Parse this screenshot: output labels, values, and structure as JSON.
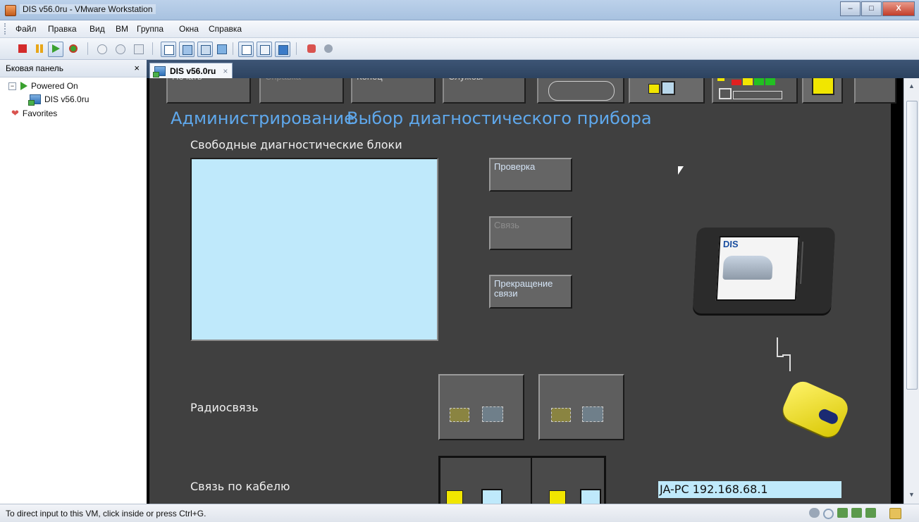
{
  "window": {
    "title": "DIS v56.0ru - VMware Workstation",
    "min": "–",
    "max": "□",
    "close": "X"
  },
  "menu": [
    "Файл",
    "Правка",
    "Вид",
    "ВМ",
    "Группа",
    "Окна",
    "Справка"
  ],
  "sidebar": {
    "title": "Бковая панель",
    "close": "×",
    "items": [
      {
        "label": "Powered On",
        "expander": "−"
      },
      {
        "label": "DIS v56.0ru"
      },
      {
        "label": "Favorites"
      }
    ]
  },
  "tab": {
    "label": "DIS v56.0ru",
    "close": "×"
  },
  "vm": {
    "top_buttons": [
      "Печать",
      "Справка",
      "Конец",
      "Службы"
    ],
    "header_left": "Администрирование",
    "header_right": "Выбор диагностического прибора",
    "free_blocks_label": "Свободные диагностические блоки",
    "btn_check": "Проверка",
    "btn_connect": "Связь",
    "btn_stop": "Прекращение связи",
    "radio_label": "Радиосвязь",
    "cable_label": "Связь по кабелю",
    "ip": "JA-PC 192.168.68.1",
    "device_brand": "DIS"
  },
  "status": {
    "message": "To direct input to this VM, click inside or press Ctrl+G."
  }
}
